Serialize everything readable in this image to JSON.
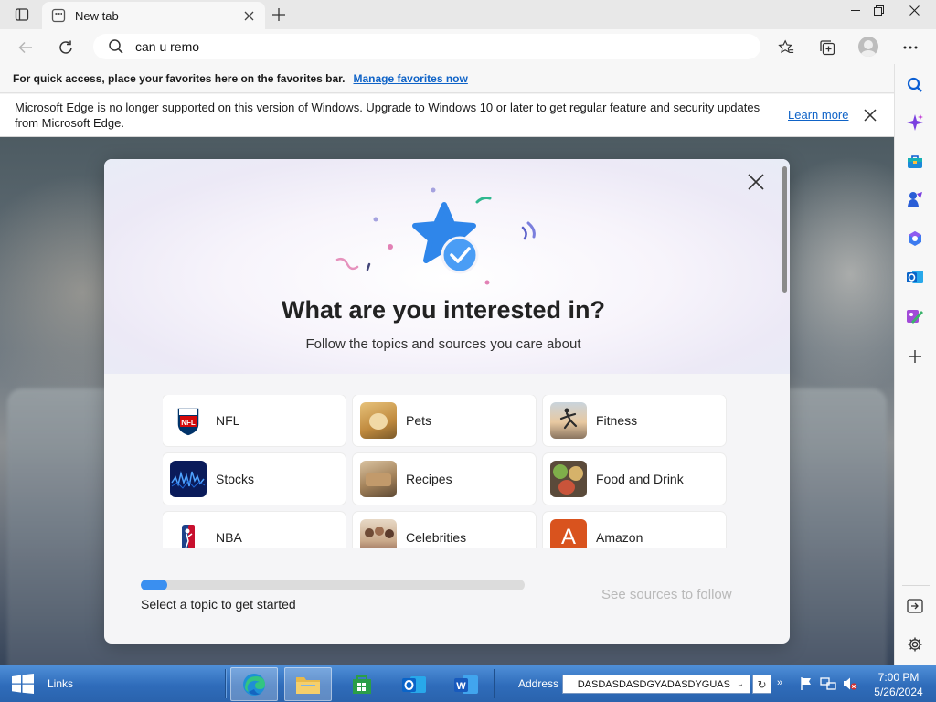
{
  "browser": {
    "tab_title": "New tab",
    "search_value": "can u remo"
  },
  "favorites_bar": {
    "text": "For quick access, place your favorites here on the favorites bar.",
    "link": "Manage favorites now"
  },
  "infobar": {
    "message": "Microsoft Edge is no longer supported on this version of Windows. Upgrade to Windows 10 or later to get regular feature and security updates from Microsoft Edge.",
    "learn_more": "Learn more"
  },
  "modal": {
    "title": "What are you interested in?",
    "subtitle": "Follow the topics and sources you care about",
    "topics": [
      {
        "label": "NFL"
      },
      {
        "label": "Pets"
      },
      {
        "label": "Fitness"
      },
      {
        "label": "Stocks"
      },
      {
        "label": "Recipes"
      },
      {
        "label": "Food and Drink"
      },
      {
        "label": "NBA"
      },
      {
        "label": "Celebrities"
      },
      {
        "label": "Amazon"
      }
    ],
    "progress_fraction": 0.07,
    "progress_label": "Select a topic to get started",
    "see_sources": "See sources to follow",
    "amazon_letter": "A",
    "nfl_badge": "NFL"
  },
  "taskbar": {
    "links_label": "Links",
    "address_label": "Address",
    "address_value": "DASDASDASDGYADASDYGUAS",
    "time": "7:00 PM",
    "date": "5/26/2024"
  },
  "colors": {
    "accent": "#0f63c7",
    "progress": "#3a8ff0",
    "taskbar": "#2f6cba"
  }
}
